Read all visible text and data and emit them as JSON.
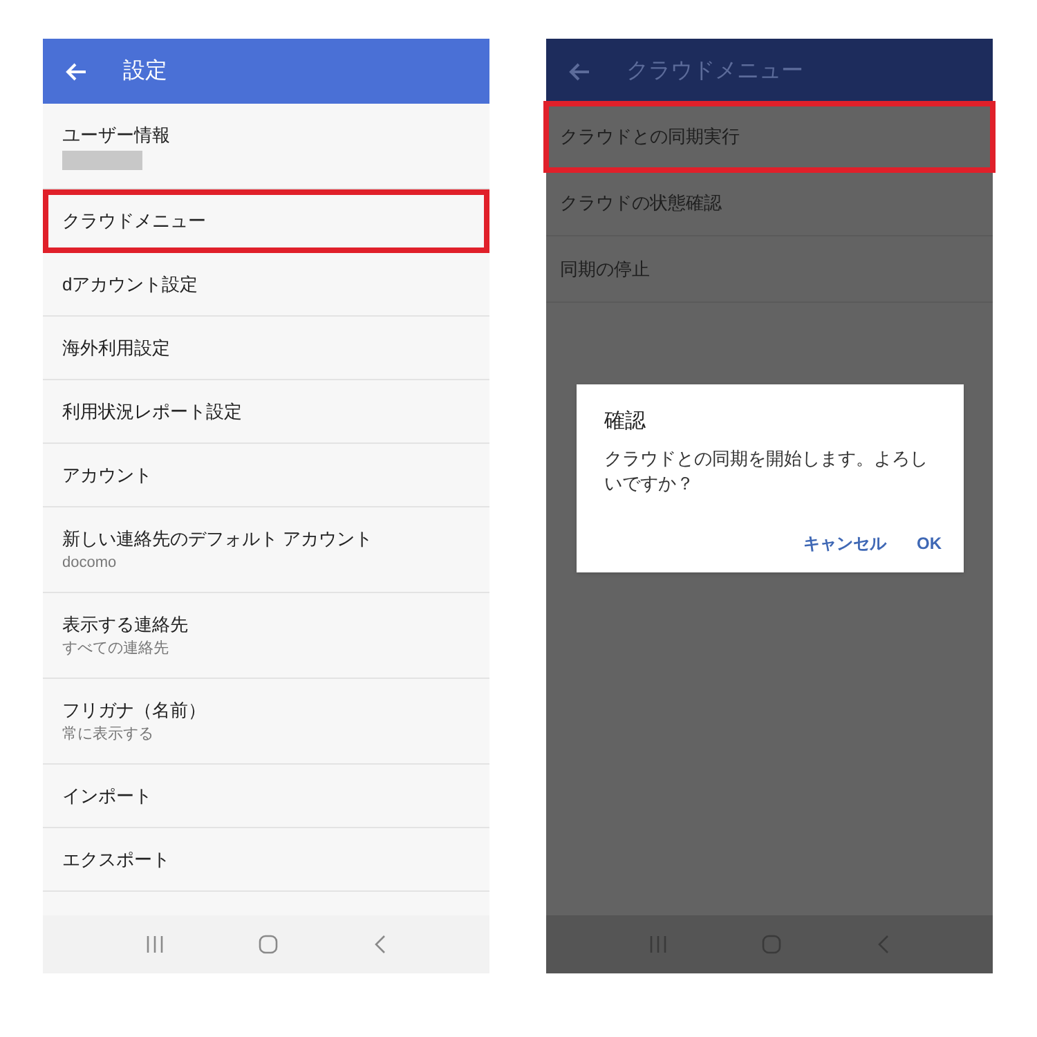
{
  "settings_screen": {
    "title": "設定",
    "items": [
      {
        "title": "ユーザー情報",
        "redacted": true,
        "highlighted": false
      },
      {
        "title": "クラウドメニュー",
        "highlighted": true
      },
      {
        "title": "dアカウント設定",
        "highlighted": false
      },
      {
        "title": "海外利用設定",
        "highlighted": false
      },
      {
        "title": "利用状況レポート設定",
        "highlighted": false
      },
      {
        "title": "アカウント",
        "highlighted": false
      },
      {
        "title": "新しい連絡先のデフォルト アカウント",
        "subtitle": "docomo",
        "highlighted": false
      },
      {
        "title": "表示する連絡先",
        "subtitle": "すべての連絡先",
        "highlighted": false
      },
      {
        "title": "フリガナ（名前）",
        "subtitle": "常に表示する",
        "highlighted": false
      },
      {
        "title": "インポート",
        "highlighted": false
      },
      {
        "title": "エクスポート",
        "highlighted": false
      }
    ]
  },
  "cloud_screen": {
    "title": "クラウドメニュー",
    "items": [
      {
        "title": "クラウドとの同期実行",
        "highlighted": true
      },
      {
        "title": "クラウドの状態確認",
        "highlighted": false
      },
      {
        "title": "同期の停止",
        "highlighted": false
      }
    ],
    "dialog": {
      "title": "確認",
      "message": "クラウドとの同期を開始します。よろしいですか？",
      "buttons": [
        "キャンセル",
        "OK"
      ]
    }
  }
}
